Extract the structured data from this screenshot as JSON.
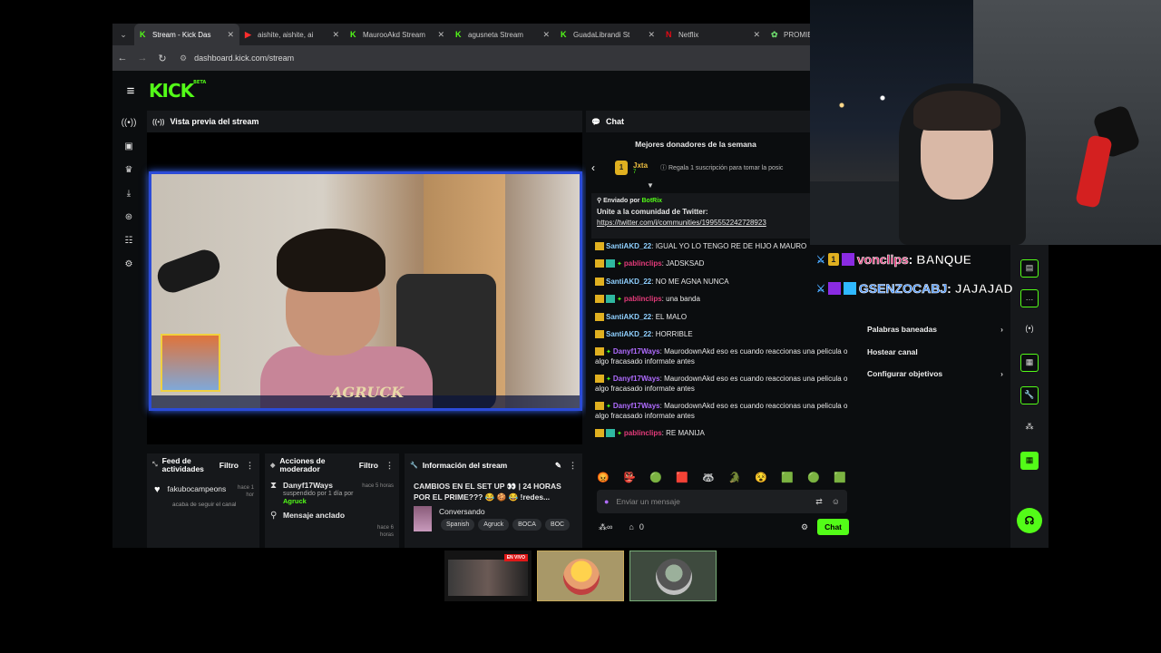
{
  "browser": {
    "tabs": [
      {
        "label": "Stream - Kick Das",
        "icon": "kick",
        "active": true
      },
      {
        "label": "aishite, aishite, ai",
        "icon": "youtube",
        "active": false
      },
      {
        "label": "MaurooAkd Stream",
        "icon": "kick",
        "active": false
      },
      {
        "label": "agusneta Stream",
        "icon": "kick",
        "active": false
      },
      {
        "label": "GuadaLibrandi St",
        "icon": "kick",
        "active": false
      },
      {
        "label": "Netflix",
        "icon": "netflix",
        "active": false
      },
      {
        "label": "PROMIEDOS - Fu",
        "icon": "promiedos",
        "active": false
      }
    ],
    "url": "dashboard.kick.com/stream"
  },
  "kick": {
    "logo": "KICK",
    "beta": "BETA"
  },
  "preview": {
    "title": "Vista previa del stream",
    "watermark": "AGRUCK"
  },
  "feed": {
    "title": "Feed de actividades",
    "filter": "Filtro",
    "user": "fakubocampeons",
    "time": "hace 1 hor",
    "event": "acaba de seguir el canal"
  },
  "mod_actions": {
    "title": "Acciones de moderador",
    "filter": "Filtro",
    "items": [
      {
        "name": "Danyf17Ways",
        "time": "hace 5 horas",
        "detail": "suspendido por 1 día por",
        "target": "Agruck"
      },
      {
        "name": "Mensaje anclado",
        "time": "hace 6 horas",
        "detail": "",
        "target": ""
      }
    ]
  },
  "stream_info": {
    "title": "Información del stream",
    "stream_title": "CAMBIOS EN EL SET UP 👀 | 24 HORAS POR EL PRIME??? 😂 🍪 😂 !redes...",
    "category": "Conversando",
    "tags": [
      "Spanish",
      "Agruck",
      "BOCA",
      "BOC"
    ]
  },
  "chat": {
    "title": "Chat",
    "donors_title": "Mejores donadores de la semana",
    "donor": {
      "rank": "1",
      "name": "Jxta",
      "count": "7",
      "gift_text": "Regala 1 suscripción para tomar la posic"
    },
    "pinned": {
      "sent_by": "Enviado por",
      "bot": "BotRix",
      "message": "Unite a la comunidad de Twitter:",
      "link": "https://twitter.com/i/communities/1995552242728923"
    },
    "messages": [
      {
        "user": "SantiAKD_22",
        "cls": "u1",
        "text": "IGUAL YO LO TENGO RE DE HIJO A MAURO"
      },
      {
        "user": "pablinclips",
        "cls": "u2",
        "text": "JADSKSAD"
      },
      {
        "user": "SantiAKD_22",
        "cls": "u1",
        "text": "NO ME AGNA NUNCA"
      },
      {
        "user": "pablinclips",
        "cls": "u2",
        "text": "una banda"
      },
      {
        "user": "SantiAKD_22",
        "cls": "u1",
        "text": "EL MALO"
      },
      {
        "user": "SantiAKD_22",
        "cls": "u1",
        "text": "HORRIBLE"
      },
      {
        "user": "Danyf17Ways",
        "cls": "u3",
        "text": "MaurodownAkd eso es cuando reaccionas una pelicula o algo fracasado informate antes"
      },
      {
        "user": "Danyf17Ways",
        "cls": "u3",
        "text": "MaurodownAkd eso es cuando reaccionas una pelicula o algo fracasado informate antes"
      },
      {
        "user": "Danyf17Ways",
        "cls": "u3",
        "text": "MaurodownAkd eso es cuando reaccionas una pelicula o algo fracasado informate antes"
      },
      {
        "user": "pablinclips",
        "cls": "u2",
        "text": "RE MANIJA"
      }
    ],
    "input_placeholder": "Enviar un mensaje",
    "viewers": "0",
    "send_label": "Chat"
  },
  "mod_menu": {
    "items": [
      {
        "label": "Palabras baneadas",
        "chevron": true
      },
      {
        "label": "Hostear canal",
        "chevron": false
      },
      {
        "label": "Configurar objetivos",
        "chevron": true
      }
    ]
  },
  "overlay_chat": [
    {
      "name": "vonclips",
      "text": "BANQUE"
    },
    {
      "name": "GSENZOCABJ",
      "text": "JAJAJAD"
    }
  ],
  "thumbnails": {
    "live_badge": "EN VIVO"
  },
  "colors": {
    "kick_green": "#53fc18",
    "accent_blue": "#2b4bd8"
  }
}
